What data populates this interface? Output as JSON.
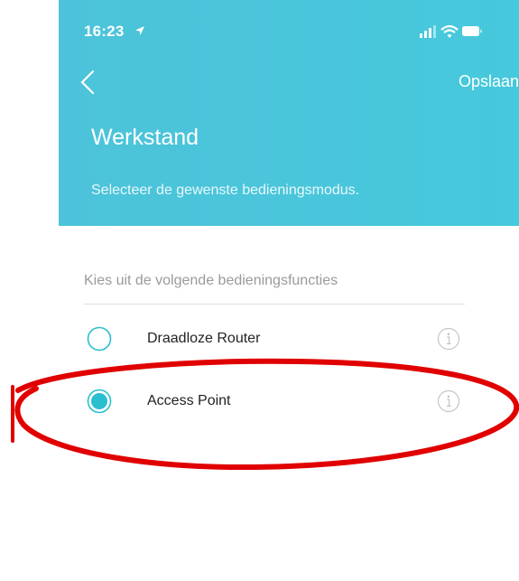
{
  "status_bar": {
    "time": "16:23",
    "icons": [
      "location-arrow-icon",
      "signal-bars-icon",
      "wifi-icon",
      "battery-icon"
    ]
  },
  "header": {
    "back_icon": "chevron-left-icon",
    "save_label": "Opslaan",
    "title": "Werkstand",
    "subtitle": "Selecteer de gewenste bedieningsmodus."
  },
  "content": {
    "section_label": "Kies uit de volgende bedieningsfuncties",
    "options": [
      {
        "label": "Draadloze Router",
        "selected": false,
        "info_icon": "info-icon"
      },
      {
        "label": "Access Point",
        "selected": true,
        "info_icon": "info-icon"
      }
    ]
  },
  "colors": {
    "header_bg": "#4cc6db",
    "accent": "#29bfd0",
    "annotation": "#e00000"
  }
}
